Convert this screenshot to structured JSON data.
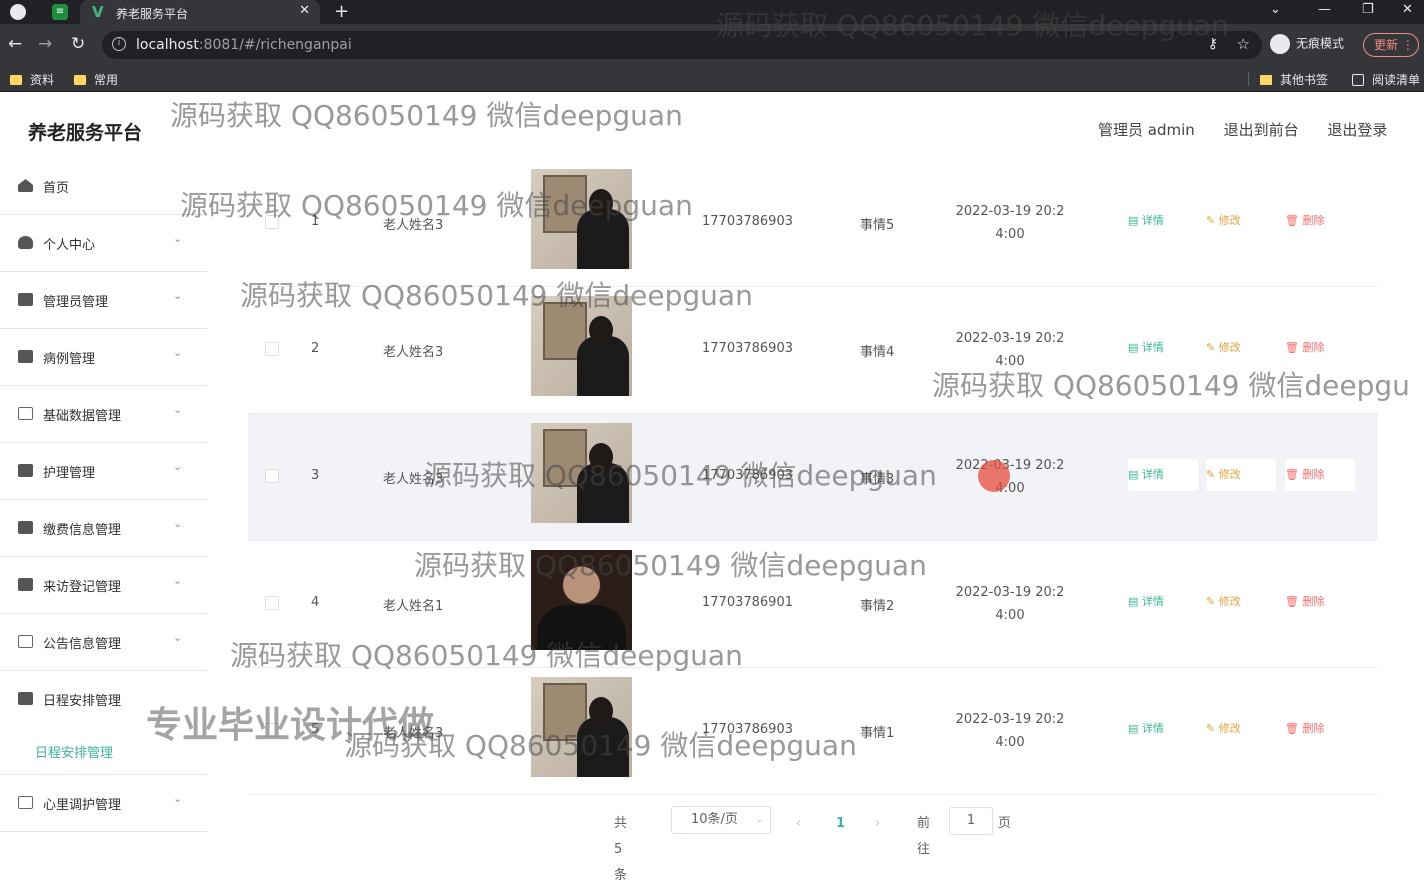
{
  "browser": {
    "tab_title": "养老服务平台",
    "url_host": "localhost",
    "url_rest": ":8081/#/richenganpai",
    "incognito_label": "无痕模式",
    "update_label": "更新",
    "bookmarks": [
      "资料",
      "常用"
    ],
    "bookmarks_right": [
      "其他书签",
      "阅读清单"
    ]
  },
  "app": {
    "title": "养老服务平台",
    "header": {
      "user": "管理员 admin",
      "front": "退出到前台",
      "logout": "退出登录"
    }
  },
  "sidebar": {
    "items": [
      {
        "label": "首页",
        "icon": "home-icon"
      },
      {
        "label": "个人中心",
        "icon": "user-icon"
      },
      {
        "label": "管理员管理",
        "icon": "chat-icon"
      },
      {
        "label": "病例管理",
        "icon": "monitor-icon"
      },
      {
        "label": "基础数据管理",
        "icon": "message-icon"
      },
      {
        "label": "护理管理",
        "icon": "camera-icon"
      },
      {
        "label": "缴费信息管理",
        "icon": "chart-bar-icon"
      },
      {
        "label": "来访登记管理",
        "icon": "trend-icon"
      },
      {
        "label": "公告信息管理",
        "icon": "mail-icon"
      },
      {
        "label": "日程安排管理",
        "icon": "pin-icon"
      }
    ],
    "sub_item": "日程安排管理",
    "last_item": {
      "label": "心里调护管理",
      "icon": "scan-icon"
    }
  },
  "table": {
    "rows": [
      {
        "index": "1",
        "name": "老人姓名3",
        "phone": "17703786903",
        "event": "事情5",
        "date": "2022-03-19 20:2",
        "time": "4:00",
        "photo": "back-view"
      },
      {
        "index": "2",
        "name": "老人姓名3",
        "phone": "17703786903",
        "event": "事情4",
        "date": "2022-03-19 20:2",
        "time": "4:00",
        "photo": "back-view"
      },
      {
        "index": "3",
        "name": "老人姓名3",
        "phone": "17703786903",
        "event": "事情3",
        "date": "2022-03-19 20:2",
        "time": "4:00",
        "photo": "back-view"
      },
      {
        "index": "4",
        "name": "老人姓名1",
        "phone": "17703786901",
        "event": "事情2",
        "date": "2022-03-19 20:2",
        "time": "4:00",
        "photo": "portrait"
      },
      {
        "index": "5",
        "name": "老人姓名3",
        "phone": "17703786903",
        "event": "事情1",
        "date": "2022-03-19 20:2",
        "time": "4:00",
        "photo": "back-view"
      }
    ],
    "actions": {
      "detail": "详情",
      "edit": "修改",
      "delete": "删除"
    }
  },
  "pager": {
    "total": "共 5 条",
    "page_size": "10条/页",
    "prev": "‹",
    "current": "1",
    "next": "›",
    "goto_label": "前往",
    "goto_value": "1",
    "page_suffix": "页"
  },
  "watermarks": {
    "text": "源码获取 QQ86050149 微信deepguan",
    "partial": "源码获取 QQ86050149 微信deepgu",
    "slogan": "专业毕业设计代做"
  },
  "colors": {
    "accent": "#3ab795",
    "warning": "#e6a23c",
    "danger": "#f56c6c"
  }
}
